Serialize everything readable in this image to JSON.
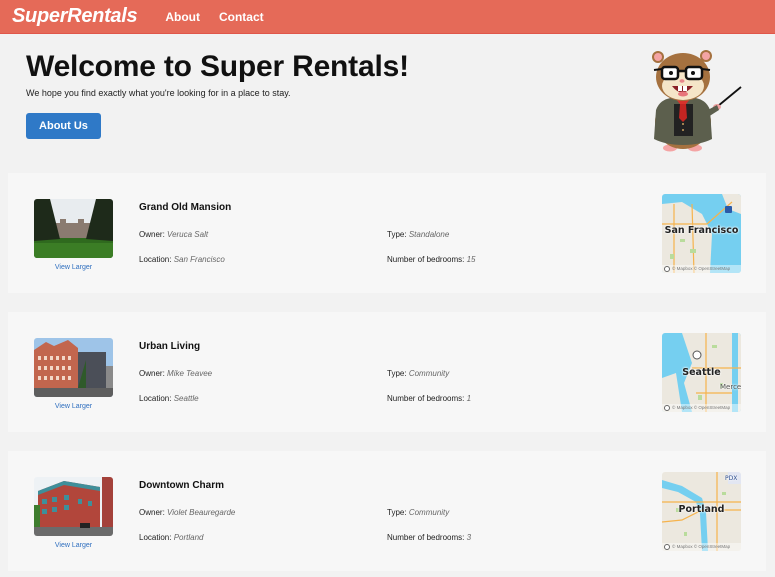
{
  "header": {
    "brand": "SuperRentals",
    "nav": [
      {
        "label": "About"
      },
      {
        "label": "Contact"
      }
    ]
  },
  "jumbo": {
    "title": "Welcome to Super Rentals!",
    "subtitle": "We hope you find exactly what you're looking for in a place to stay.",
    "button_label": "About Us",
    "mascot": "hamster-teacher-mascot"
  },
  "labels": {
    "owner": "Owner:",
    "location": "Location:",
    "type": "Type:",
    "bedrooms": "Number of bedrooms:",
    "view_larger": "View Larger",
    "map_credit": "© Mapbox © OpenStreetMap"
  },
  "rentals": [
    {
      "title": "Grand Old Mansion",
      "owner": "Veruca Salt",
      "location": "San Francisco",
      "type": "Standalone",
      "bedrooms": "15",
      "map_label": "San Francisco"
    },
    {
      "title": "Urban Living",
      "owner": "Mike Teavee",
      "location": "Seattle",
      "type": "Community",
      "bedrooms": "1",
      "map_label": "Seattle",
      "map_extra_label": "Mercer"
    },
    {
      "title": "Downtown Charm",
      "owner": "Violet Beauregarde",
      "location": "Portland",
      "type": "Community",
      "bedrooms": "3",
      "map_label": "Portland",
      "map_extra_label": "PDX"
    }
  ],
  "colors": {
    "header": "#e56a58",
    "button": "#2f79c7",
    "link": "#2f6fbf",
    "background": "#f2f2f2",
    "card": "#f7f7f7"
  }
}
